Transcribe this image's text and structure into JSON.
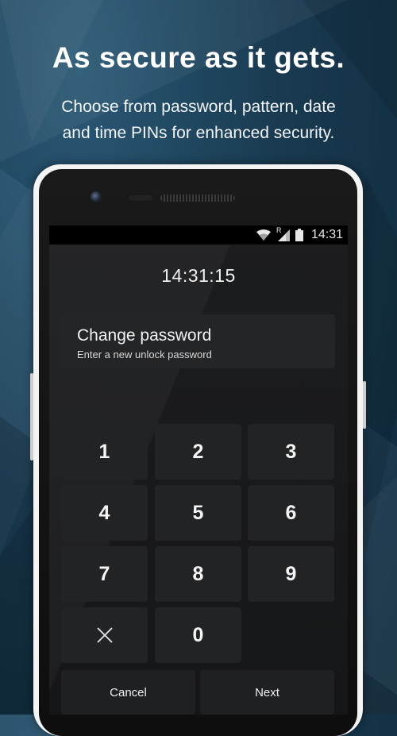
{
  "promo": {
    "headline": "As secure as it gets.",
    "subtext_line1": "Choose from password, pattern, date",
    "subtext_line2": "and time PINs for enhanced security."
  },
  "status_bar": {
    "time": "14:31",
    "icons": [
      "wifi-icon",
      "signal-roaming-icon",
      "battery-icon"
    ],
    "roaming_label": "R"
  },
  "lock_screen": {
    "clock": "14:31:15",
    "prompt_title": "Change password",
    "prompt_subtitle": "Enter a new unlock password"
  },
  "keypad": {
    "keys": [
      "1",
      "2",
      "3",
      "4",
      "5",
      "6",
      "7",
      "8",
      "9",
      "",
      "0"
    ],
    "clear_icon": "close-icon"
  },
  "actions": {
    "cancel_label": "Cancel",
    "next_label": "Next"
  },
  "colors": {
    "background": "#163a52",
    "phone_body": "#f4f4f4",
    "screen": "#1c1d1f",
    "key": "#222325"
  }
}
